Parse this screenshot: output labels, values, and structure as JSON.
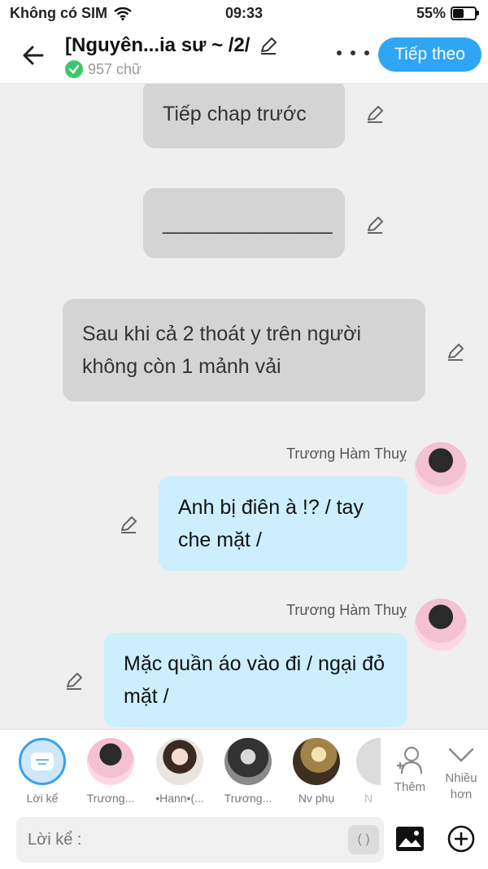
{
  "status_bar": {
    "carrier": "Không có SIM",
    "time": "09:33",
    "battery": "55%",
    "battery_level": 0.55
  },
  "header": {
    "title": "[Nguyên...ia sư ~ /2/",
    "word_count": "957 chữ",
    "next_button": "Tiếp theo"
  },
  "messages": [
    {
      "type": "narration",
      "text": "Tiếp chap trước"
    },
    {
      "type": "narration",
      "text": "_______________"
    },
    {
      "type": "narration",
      "text": "Sau khi cả 2 thoát y trên người không còn 1 mảnh vải"
    },
    {
      "type": "character",
      "speaker": "Trương Hàm Thuỵ",
      "text": "Anh bị điên à !? / tay che mặt /"
    },
    {
      "type": "character",
      "speaker": "Trương Hàm Thuỵ",
      "text": "Mặc quần áo vào đi / ngại đỏ mặt /"
    }
  ],
  "characters": [
    {
      "name": "Lời kể"
    },
    {
      "name": "Trương..."
    },
    {
      "name": "•Hann•(..."
    },
    {
      "name": "Trương..."
    },
    {
      "name": "Nv phụ"
    },
    {
      "name": "N"
    }
  ],
  "actions": {
    "add_label": "Thêm",
    "more_label": "Nhiều hơn"
  },
  "input": {
    "placeholder": "Lời kể :",
    "paren": "( )"
  },
  "colors": {
    "accent": "#2fa6f4",
    "narration_bubble": "#d4d4d4",
    "character_bubble": "#cdeefc"
  }
}
